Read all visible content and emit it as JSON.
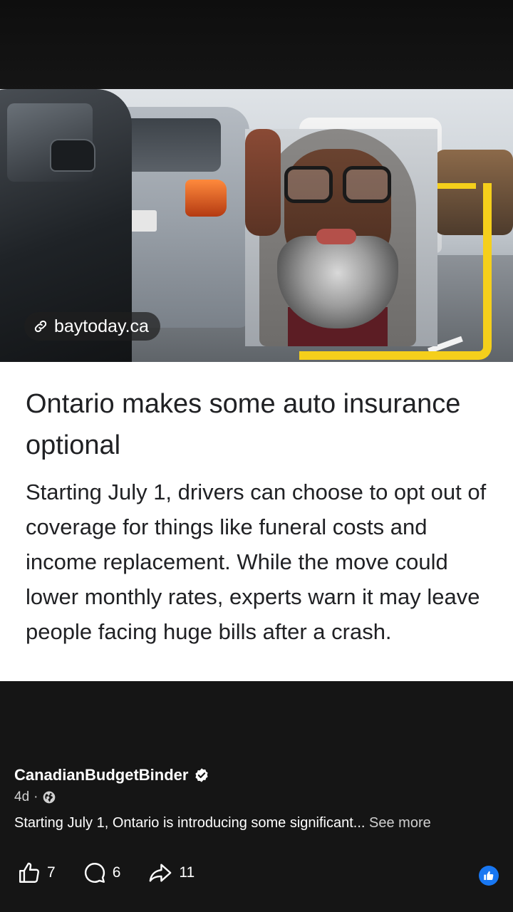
{
  "media": {
    "source_domain": "baytoday.ca",
    "accent_color": "#f5cf1b"
  },
  "article": {
    "headline": "Ontario makes some auto insurance optional",
    "summary": "Starting July 1, drivers can choose to opt out of coverage for things like funeral costs and income replacement. While the move could lower monthly rates, experts warn it may leave people facing huge bills after a crash."
  },
  "post": {
    "author": "CanadianBudgetBinder",
    "age": "4d",
    "separator": "·",
    "visibility_icon": "globe-icon",
    "caption": "Starting July 1, Ontario is introducing some significant...",
    "see_more_label": "See more"
  },
  "actions": {
    "likes": "7",
    "comments": "6",
    "shares": "11",
    "reaction_color": "#1877f2"
  }
}
